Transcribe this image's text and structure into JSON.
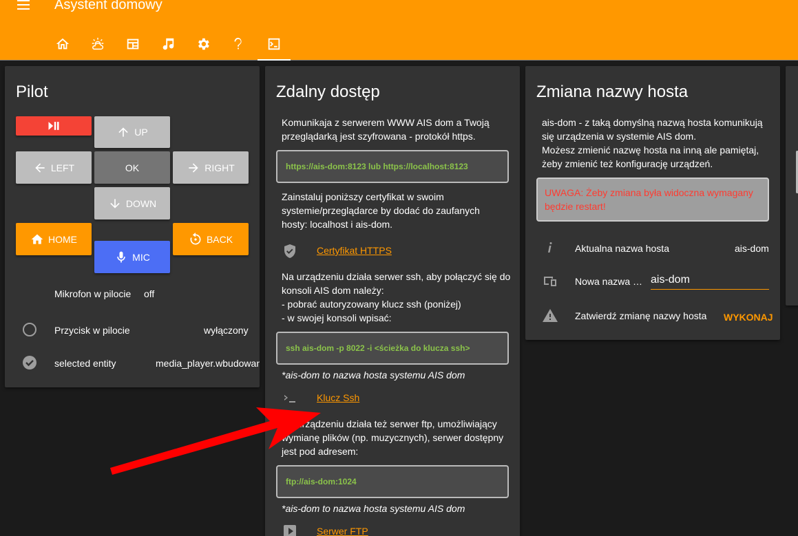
{
  "header": {
    "title": "Asystent domowy",
    "tabs": [
      "home-icon",
      "weather-icon",
      "table-icon",
      "music-icon",
      "settings-icon",
      "help-icon",
      "console-icon"
    ]
  },
  "pilot": {
    "title": "Pilot",
    "buttons": {
      "up": "UP",
      "left": "LEFT",
      "ok": "OK",
      "right": "RIGHT",
      "down": "DOWN",
      "home": "HOME",
      "back": "BACK",
      "mic": "MIC"
    },
    "rows": [
      {
        "label": "Mikrofon w pilocie",
        "value": "off"
      },
      {
        "label": "Przycisk w pilocie",
        "value": "wyłączony"
      },
      {
        "label": "selected entity",
        "value": "media_player.wbudowany"
      }
    ]
  },
  "remote": {
    "title": "Zdalny dostęp",
    "p1": "Komunikaja z serwerem WWW AIS dom a Twoją przeglądarką jest szyfrowana - protokół https.",
    "code1": "https://ais-dom:8123 lub https://localhost:8123",
    "p2": "Zainstaluj poniższy certyfikat w swoim systemie/przeglądarce by dodać do zaufanych hosty: localhost i ais-dom.",
    "link1": "Certyfikat HTTPS",
    "p3_l1": "Na urządzeniu działa serwer ssh, aby połączyć się do konsoli AIS dom należy:",
    "p3_l2": "- pobrać autoryzowany klucz ssh (poniżej)",
    "p3_l3": "- w swojej konsoli wpisać:",
    "code2": "ssh ais-dom -p 8022 -i <ścieżka do klucza ssh>",
    "note1": "*ais-dom to nazwa hosta systemu AIS dom",
    "link2": "Klucz Ssh",
    "p4": "Na urządzeniu działa też serwer ftp, umożliwiający wymianę plików (np. muzycznych), serwer dostępny jest pod adresem:",
    "code3": "ftp://ais-dom:1024",
    "note2": "*ais-dom to nazwa hosta systemu AIS dom",
    "link3": "Serwer FTP"
  },
  "hostname": {
    "title": "Zmiana nazwy hosta",
    "p1": "ais-dom - z taką domyślną nazwą hosta komunikują się urządzenia w systemie AIS dom.",
    "p2": "Możesz zmienić nazwę hosta na inną ale pamiętaj, żeby zmienić też konfigurację urządzeń.",
    "warning": "UWAGA: Żeby zmiana była widoczna wymagany będzie restart!",
    "current_label": "Aktualna nazwa hosta",
    "current_value": "ais-dom",
    "new_label": "Nowa nazwa …",
    "new_value": "ais-dom",
    "confirm_label": "Zatwierdź zmianę nazwy hosta",
    "confirm_button": "WYKONAJ"
  },
  "colors": {
    "accent": "#ff9800",
    "card": "#333333",
    "background": "#1b1b1b",
    "code_text": "#8bc34a",
    "warning_text": "#ff3b30",
    "arrow": "#ff0000"
  }
}
